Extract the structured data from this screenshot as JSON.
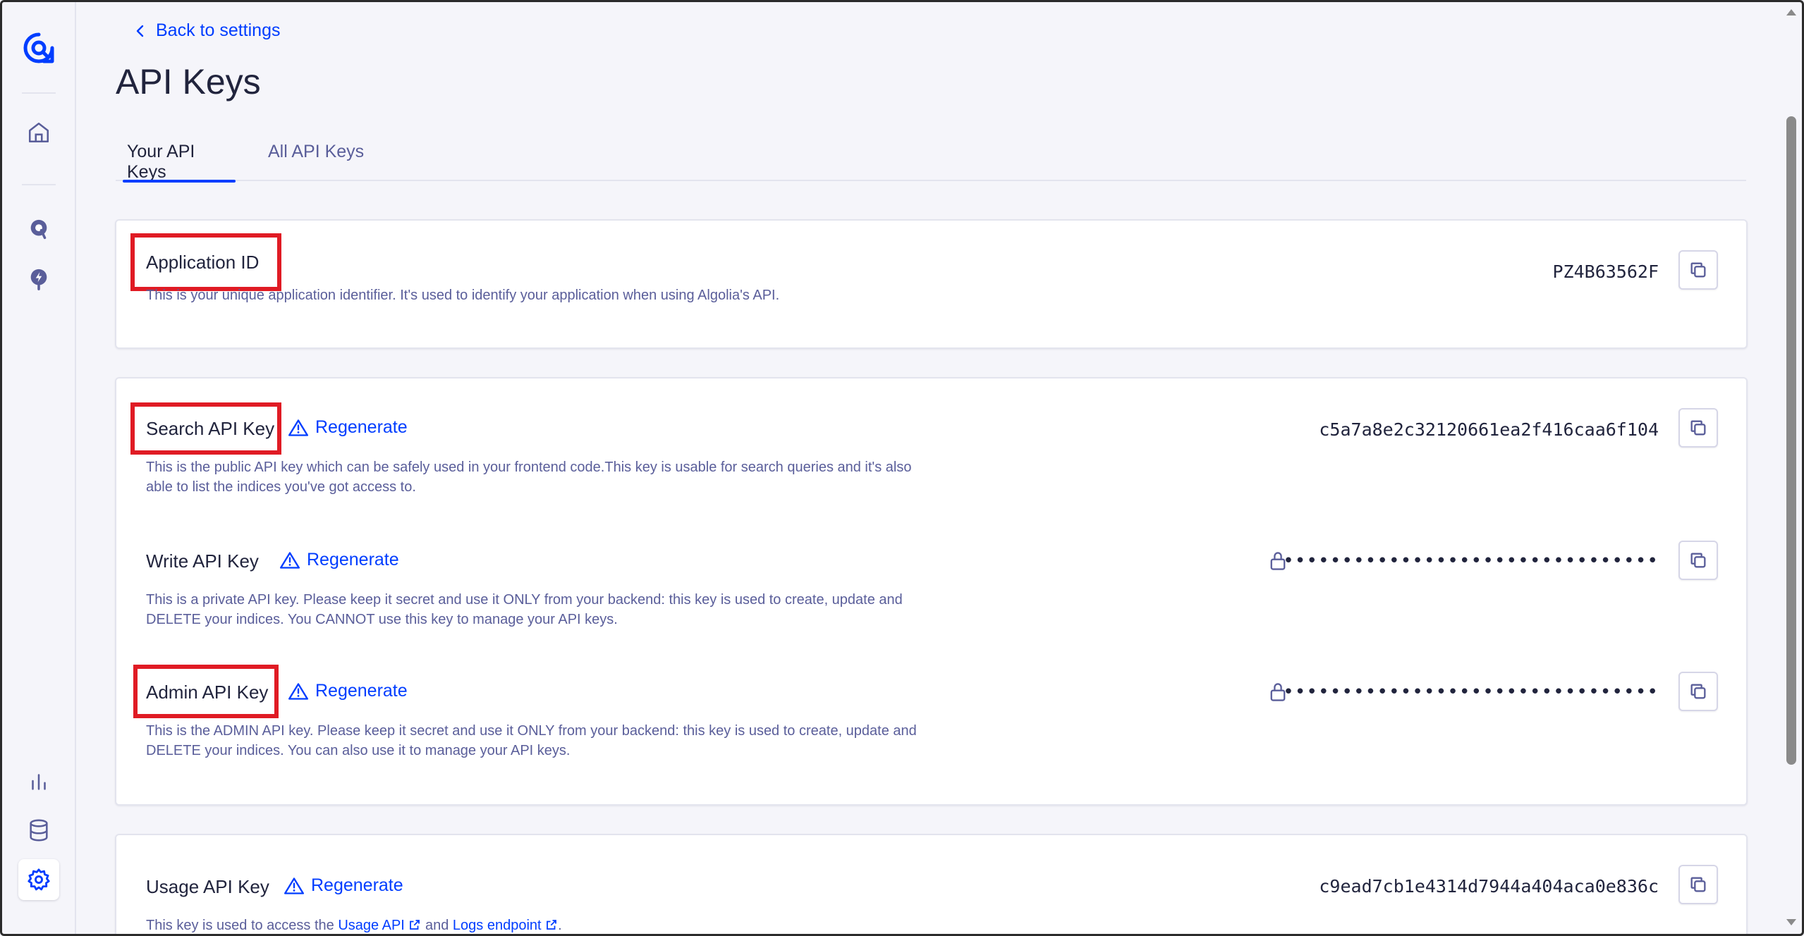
{
  "sidebar": {
    "logo": "algolia-logo-icon",
    "items": [
      {
        "name": "home",
        "icon": "home-icon"
      },
      {
        "name": "search",
        "icon": "search-pin-icon"
      },
      {
        "name": "recommend",
        "icon": "bolt-pin-icon"
      },
      {
        "name": "analytics",
        "icon": "bar-chart-icon"
      },
      {
        "name": "data-sources",
        "icon": "database-icon"
      },
      {
        "name": "settings",
        "icon": "gear-icon",
        "active": true
      }
    ]
  },
  "header": {
    "back_label": "Back to settings",
    "title": "API Keys"
  },
  "tabs": [
    {
      "label": "Your API Keys",
      "active": true
    },
    {
      "label": "All API Keys",
      "active": false
    }
  ],
  "application_id": {
    "label": "Application ID",
    "description": "This is your unique application identifier. It's used to identify your application when using Algolia's API.",
    "value": "PZ4B63562F"
  },
  "search_key": {
    "label": "Search API Key",
    "regenerate": "Regenerate",
    "description": "This is the public API key which can be safely used in your frontend code.This key is usable for search queries and it's also able to list the indices you've got access to.",
    "value": "c5a7a8e2c32120661ea2f416caa6f104"
  },
  "write_key": {
    "label": "Write API Key",
    "regenerate": "Regenerate",
    "description": "This is a private API key. Please keep it secret and use it ONLY from your backend: this key is used to create, update and DELETE your indices. You CANNOT use this key to manage your API keys.",
    "value": "••••••••••••••••••••••••••••••••"
  },
  "admin_key": {
    "label": "Admin API Key",
    "regenerate": "Regenerate",
    "description": "This is the ADMIN API key. Please keep it secret and use it ONLY from your backend: this key is used to create, update and DELETE your indices. You can also use it to manage your API keys.",
    "value": "••••••••••••••••••••••••••••••••"
  },
  "usage_key": {
    "label": "Usage API Key",
    "regenerate": "Regenerate",
    "description_prefix": "This key is used to access the ",
    "link_usage": "Usage API",
    "description_middle": " and ",
    "link_logs": "Logs endpoint",
    "description_suffix": ".",
    "value": "c9ead7cb1e4314d7944a404aca0e836c"
  },
  "colors": {
    "accent": "#003dff",
    "highlight": "#e01b24",
    "text": "#21243d",
    "muted": "#5a5e9a"
  }
}
